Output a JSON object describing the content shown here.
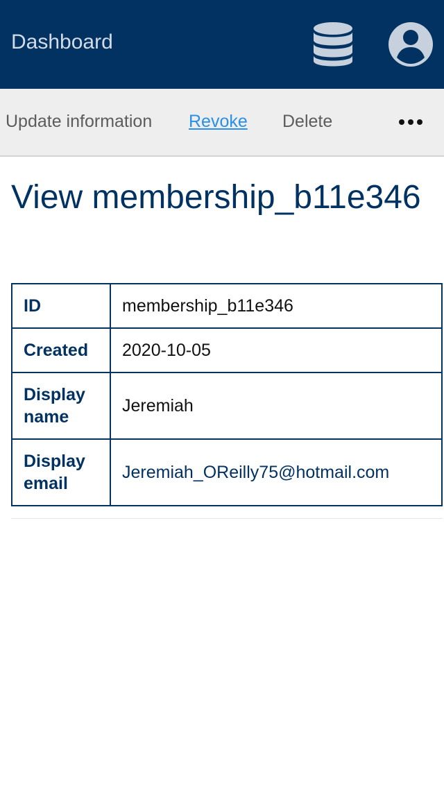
{
  "header": {
    "title": "Dashboard",
    "icons": [
      "database-icon",
      "user-account-icon"
    ],
    "background_color": "#023262"
  },
  "actions": {
    "update_label": "Update information",
    "revoke_label": "Revoke",
    "delete_label": "Delete",
    "more_icon": "ellipsis-icon"
  },
  "page": {
    "title": "View membership_b11e346"
  },
  "details": {
    "rows": [
      {
        "key": "ID",
        "value": "membership_b11e346"
      },
      {
        "key": "Created",
        "value": "2020-10-05"
      },
      {
        "key": "Display name",
        "value": "Jeremiah"
      },
      {
        "key": "Display email",
        "value": "Jeremiah_OReilly75@hotmail.com"
      }
    ]
  },
  "colors": {
    "primary": "#023262",
    "link": "#2a8fe6",
    "action_bar": "#eeeeee"
  }
}
